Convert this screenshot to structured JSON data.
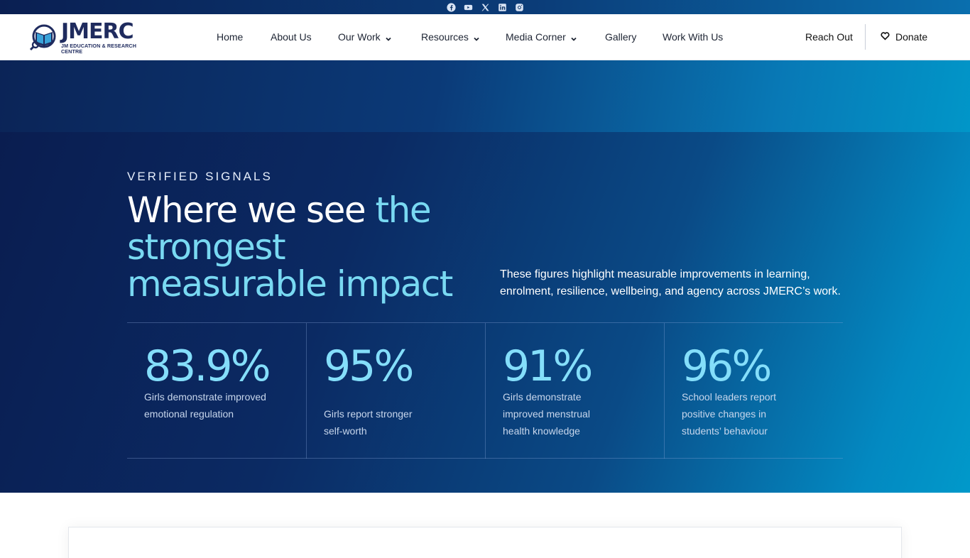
{
  "topbar": {
    "social": [
      "facebook-icon",
      "youtube-icon",
      "x-icon",
      "linkedin-icon",
      "instagram-icon"
    ]
  },
  "header": {
    "logo": {
      "name": "JMERC",
      "subtitle": "JM EDUCATION & RESEARCH CENTRE"
    },
    "nav": [
      {
        "label": "Home"
      },
      {
        "label": "About Us"
      },
      {
        "label": "Our Work",
        "dropdown": true
      },
      {
        "label": "Resources",
        "dropdown": true
      },
      {
        "label": "Media Corner",
        "dropdown": true
      },
      {
        "label": "Gallery"
      },
      {
        "label": "Work With Us"
      }
    ],
    "reach_out": "Reach Out",
    "donate": "Donate"
  },
  "hero": {
    "eyebrow": "VERIFIED SIGNALS",
    "headline_plain": "Where we see ",
    "headline_highlight": "the strongest measurable impact",
    "description": "These figures highlight measurable improvements in learning, enrolment, resilience, wellbeing, and agency across JMERC’s work.",
    "stats": [
      {
        "value": "83.9%",
        "label": "Girls demonstrate improved emotional regulation"
      },
      {
        "value": "95%",
        "label": "Girls report stronger self-worth"
      },
      {
        "value": "91%",
        "label": "Girls demonstrate improved menstrual health knowledge"
      },
      {
        "value": "96%",
        "label": "School leaders report positive changes in students’ behaviour"
      }
    ]
  },
  "colors": {
    "accent": "#79d9f2",
    "brand_navy": "#1f2b5e",
    "hero_dark": "#0a1d50",
    "hero_light": "#0199ca"
  }
}
